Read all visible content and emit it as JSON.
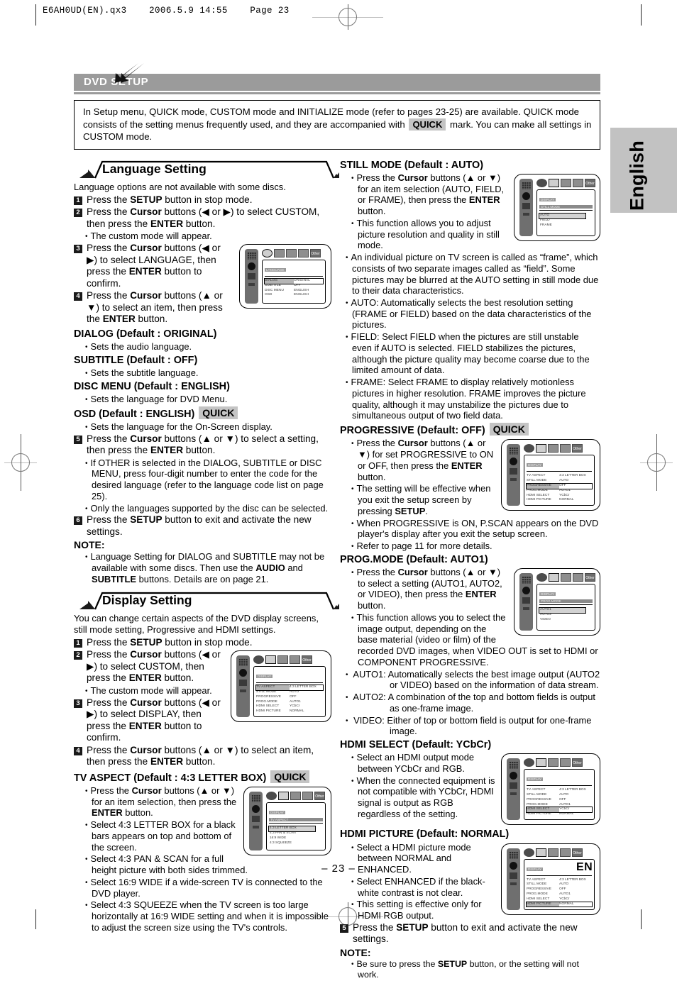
{
  "meta": {
    "filestamp": "E6AH0UD(EN).qx3    2006.5.9 14:55    Page 23",
    "side_tab": "English",
    "page_number": "– 23 –",
    "lang_code": "EN"
  },
  "section": {
    "bar_title": "DVD SETUP",
    "intro": "In Setup menu, QUICK mode, CUSTOM mode and INITIALIZE mode (refer to pages 23-25) are available. QUICK mode consists of the setting menus frequently used, and they are accompanied with",
    "intro_quick_badge": "QUICK",
    "intro_tail": "mark. You can make all settings in CUSTOM mode."
  },
  "language_setting": {
    "title": "Language Setting",
    "lead": "Language options are not available with some discs.",
    "steps": [
      {
        "n": "1",
        "text_html": "Press the <b>SETUP</b> button in stop mode."
      },
      {
        "n": "2",
        "text_html": "Press the <b>Cursor</b> buttons (◀ or ▶) to select CUSTOM, then press the <b>ENTER</b> button."
      },
      {
        "n": "3",
        "text_html": "Press the <b>Cursor</b> buttons (◀ or ▶) to select LANGUAGE, then press the <b>ENTER</b> button to confirm."
      },
      {
        "n": "4",
        "text_html": "Press the <b>Cursor</b> buttons (▲ or ▼) to select an item, then press the <b>ENTER</b> button."
      },
      {
        "n": "5",
        "text_html": "Press the <b>Cursor</b> buttons (▲ or ▼) to select a setting, then press the <b>ENTER</b> button."
      },
      {
        "n": "6",
        "text_html": "Press the <b>SETUP</b> button to exit and activate the new settings."
      }
    ],
    "step2_note": "The custom mode will appear.",
    "items": [
      {
        "head": "DIALOG (Default : ORIGINAL)",
        "quick": false,
        "bullet": "Sets the audio language."
      },
      {
        "head": "SUBTITLE (Default : OFF)",
        "quick": false,
        "bullet": "Sets the subtitle language."
      },
      {
        "head": "DISC MENU (Default : ENGLISH)",
        "quick": false,
        "bullet": "Sets the language for DVD Menu."
      },
      {
        "head": "OSD (Default : ENGLISH)",
        "quick": true,
        "bullet": "Sets the language for the On-Screen display."
      }
    ],
    "step5_bullets": [
      "If OTHER is selected in the DIALOG, SUBTITLE or DISC MENU, press four-digit number to enter the code for the desired language (refer to the language code list on page 25).",
      "Only the languages supported by the disc can be selected."
    ],
    "note_heading": "NOTE:",
    "note_html": "Language Setting for DIALOG and SUBTITLE may not be available with some discs. Then use the <b>AUDIO</b> and <b>SUBTITLE</b> buttons. Details are on page 21.",
    "osd_screen": {
      "title": "LANGUAGE",
      "rows": [
        {
          "key": "DIALOG",
          "value": "ORIGINAL",
          "highlight": true
        },
        {
          "key": "SUBTITLE",
          "value": "OFF",
          "highlight": false
        },
        {
          "key": "DISC MENU",
          "value": "ENGLISH",
          "highlight": false
        },
        {
          "key": "OSD",
          "value": "ENGLISH",
          "highlight": false
        }
      ],
      "selected_icon": "disc-icon"
    }
  },
  "display_setting": {
    "title": "Display Setting",
    "lead": "You can change certain aspects of the DVD display screens, still mode setting, Progressive and HDMI settings.",
    "steps": [
      {
        "n": "1",
        "text_html": "Press the <b>SETUP</b> button in stop mode."
      },
      {
        "n": "2",
        "text_html": "Press the <b>Cursor</b> buttons (◀ or ▶) to select CUSTOM, then press the <b>ENTER</b> button."
      },
      {
        "n": "3",
        "text_html": "Press the <b>Cursor</b> buttons (◀ or ▶) to select DISPLAY, then press the <b>ENTER</b> button to confirm."
      },
      {
        "n": "4",
        "text_html": "Press the <b>Cursor</b> buttons (▲ or ▼) to select an item, then press the <b>ENTER</b> button."
      },
      {
        "n": "5",
        "text_html": "Press the <b>SETUP</b> button to exit and activate the new settings."
      }
    ],
    "step2_note": "The custom mode will appear.",
    "osd_screen": {
      "title": "DISPLAY",
      "rows": [
        {
          "key": "TV ASPECT",
          "value": "4:3 LETTER BOX",
          "highlight": true
        },
        {
          "key": "STILL MODE",
          "value": "AUTO",
          "highlight": false
        },
        {
          "key": "PROGRESSIVE",
          "value": "OFF",
          "highlight": false
        },
        {
          "key": "PROG.MODE",
          "value": "AUTO1",
          "highlight": false
        },
        {
          "key": "HDMI SELECT",
          "value": "YCbCr",
          "highlight": false
        },
        {
          "key": "HDMI PICTURE",
          "value": "NORMAL",
          "highlight": false
        }
      ]
    },
    "note_heading": "NOTE:",
    "note_html": "Be sure to press the <b>SETUP</b> button, or the setting will not work."
  },
  "tv_aspect": {
    "head": "TV ASPECT (Default : 4:3 LETTER BOX)",
    "quick": true,
    "bullets": [
      "Press the <b>Cursor</b> buttons (▲ or ▼) for an item selection, then press the <b>ENTER</b> button.",
      "Select 4:3 LETTER BOX for a black bars appears on top and bottom of the screen.",
      "Select 4:3 PAN &amp; SCAN for a full height picture with both sides trimmed.",
      "Select 16:9 WIDE if a wide-screen TV is connected to the DVD player.",
      "Select 4:3 SQUEEZE when the TV screen is too large horizontally at 16:9 WIDE setting and when it is impossible to adjust the screen size using the TV's controls."
    ],
    "osd_screen": {
      "title": "DISPLAY",
      "subtitle": "TV ASPECT",
      "options": [
        "4:3 LETTER BOX",
        "4:3 PAN & SCAN",
        "16:9 WIDE",
        "4:3 SQUEEZE"
      ],
      "selected_index": 0
    }
  },
  "still_mode": {
    "head": "STILL MODE (Default : AUTO)",
    "quick": false,
    "bullets": [
      "Press the <b>Cursor</b> buttons (▲ or ▼) for an item selection (AUTO, FIELD, or FRAME), then press the <b>ENTER</b> button.",
      "This function allows you to adjust picture resolution and quality in still mode.",
      "An individual picture on TV screen is called as “frame”, which consists of two separate images called as “field”. Some pictures may be blurred at the AUTO setting in still mode due to their data characteristics.",
      "AUTO: Automatically selects the best resolution setting (FRAME or FIELD) based on the data characteristics of the pictures.",
      "FIELD: Select FIELD when the pictures are still unstable even if AUTO is selected.  FIELD stabilizes the pictures, although the picture quality may become coarse due to the limited amount of data.",
      "FRAME: Select FRAME to display relatively motionless pictures in higher resolution. FRAME improves the picture quality, although it may unstabilize the pictures due to simultaneous output of two field data."
    ],
    "osd_screen": {
      "title": "DISPLAY",
      "subtitle": "STILL MODE",
      "options": [
        "AUTO",
        "FIELD",
        "FRAME"
      ],
      "selected_index": 0
    }
  },
  "progressive": {
    "head": "PROGRESSIVE (Default: OFF)",
    "quick": true,
    "bullets": [
      "Press the <b>Cursor</b> buttons (▲ or ▼) for set PROGRESSIVE to ON or OFF, then press the <b>ENTER</b> button.",
      "The setting will be effective when you exit the setup screen by pressing <b>SETUP</b>.",
      "When PROGRESSIVE is ON, P.SCAN appears on the DVD player's display after you exit the setup screen.",
      "Refer to page 11 for more details."
    ],
    "osd_highlight_row": "PROGRESSIVE"
  },
  "prog_mode": {
    "head": "PROG.MODE (Default: AUTO1)",
    "quick": false,
    "bullets": [
      "Press the <b>Cursor</b> buttons (▲ or ▼) to select a setting (AUTO1, AUTO2, or VIDEO), then press the <b>ENTER</b> button.",
      "This function allows you to select the image output, depending on the base material (video or film) of the recorded DVD images, when VIDEO OUT is set to HDMI or COMPONENT PROGRESSIVE."
    ],
    "defs": [
      {
        "term": "AUTO1:",
        "text": "Automatically selects the best image output (AUTO2 or VIDEO) based on the information of data stream."
      },
      {
        "term": "AUTO2:",
        "text": "A combination of the top and bottom fields is output as one-frame image."
      },
      {
        "term": "VIDEO:",
        "text": "Either of top or bottom field is output for one-frame image."
      }
    ],
    "osd_screen": {
      "title": "DISPLAY",
      "subtitle": "PROG.MODE",
      "options": [
        "AUTO1",
        "AUTO2",
        "VIDEO"
      ],
      "selected_index": 0
    }
  },
  "hdmi_select": {
    "head": "HDMI SELECT (Default: YCbCr)",
    "quick": false,
    "bullets": [
      "Select an HDMI output mode between YCbCr and RGB.",
      "When the connected equipment is not compatible with YCbCr, HDMI signal is output as RGB regardless of the setting."
    ],
    "osd_highlight_row": "HDMI SELECT"
  },
  "hdmi_picture": {
    "head": "HDMI PICTURE (Default: NORMAL)",
    "quick": false,
    "bullets": [
      "Select a HDMI picture mode between NORMAL and ENHANCED.",
      "Select ENHANCED if the black-white contrast is not clear.",
      "This setting is effective only for HDMI RGB output."
    ],
    "osd_highlight_row": "HDMI PICTURE"
  },
  "icons": {
    "bar": [
      "disc-icon",
      "monitor-icon",
      "speaker-icon",
      "wrench-icon",
      "other-icon"
    ],
    "other_label": "Other"
  },
  "colors": {
    "bar_gray": "#9b9b9b",
    "quick_badge": "#c4c4c4",
    "side_tab": "#c2c2c2"
  }
}
